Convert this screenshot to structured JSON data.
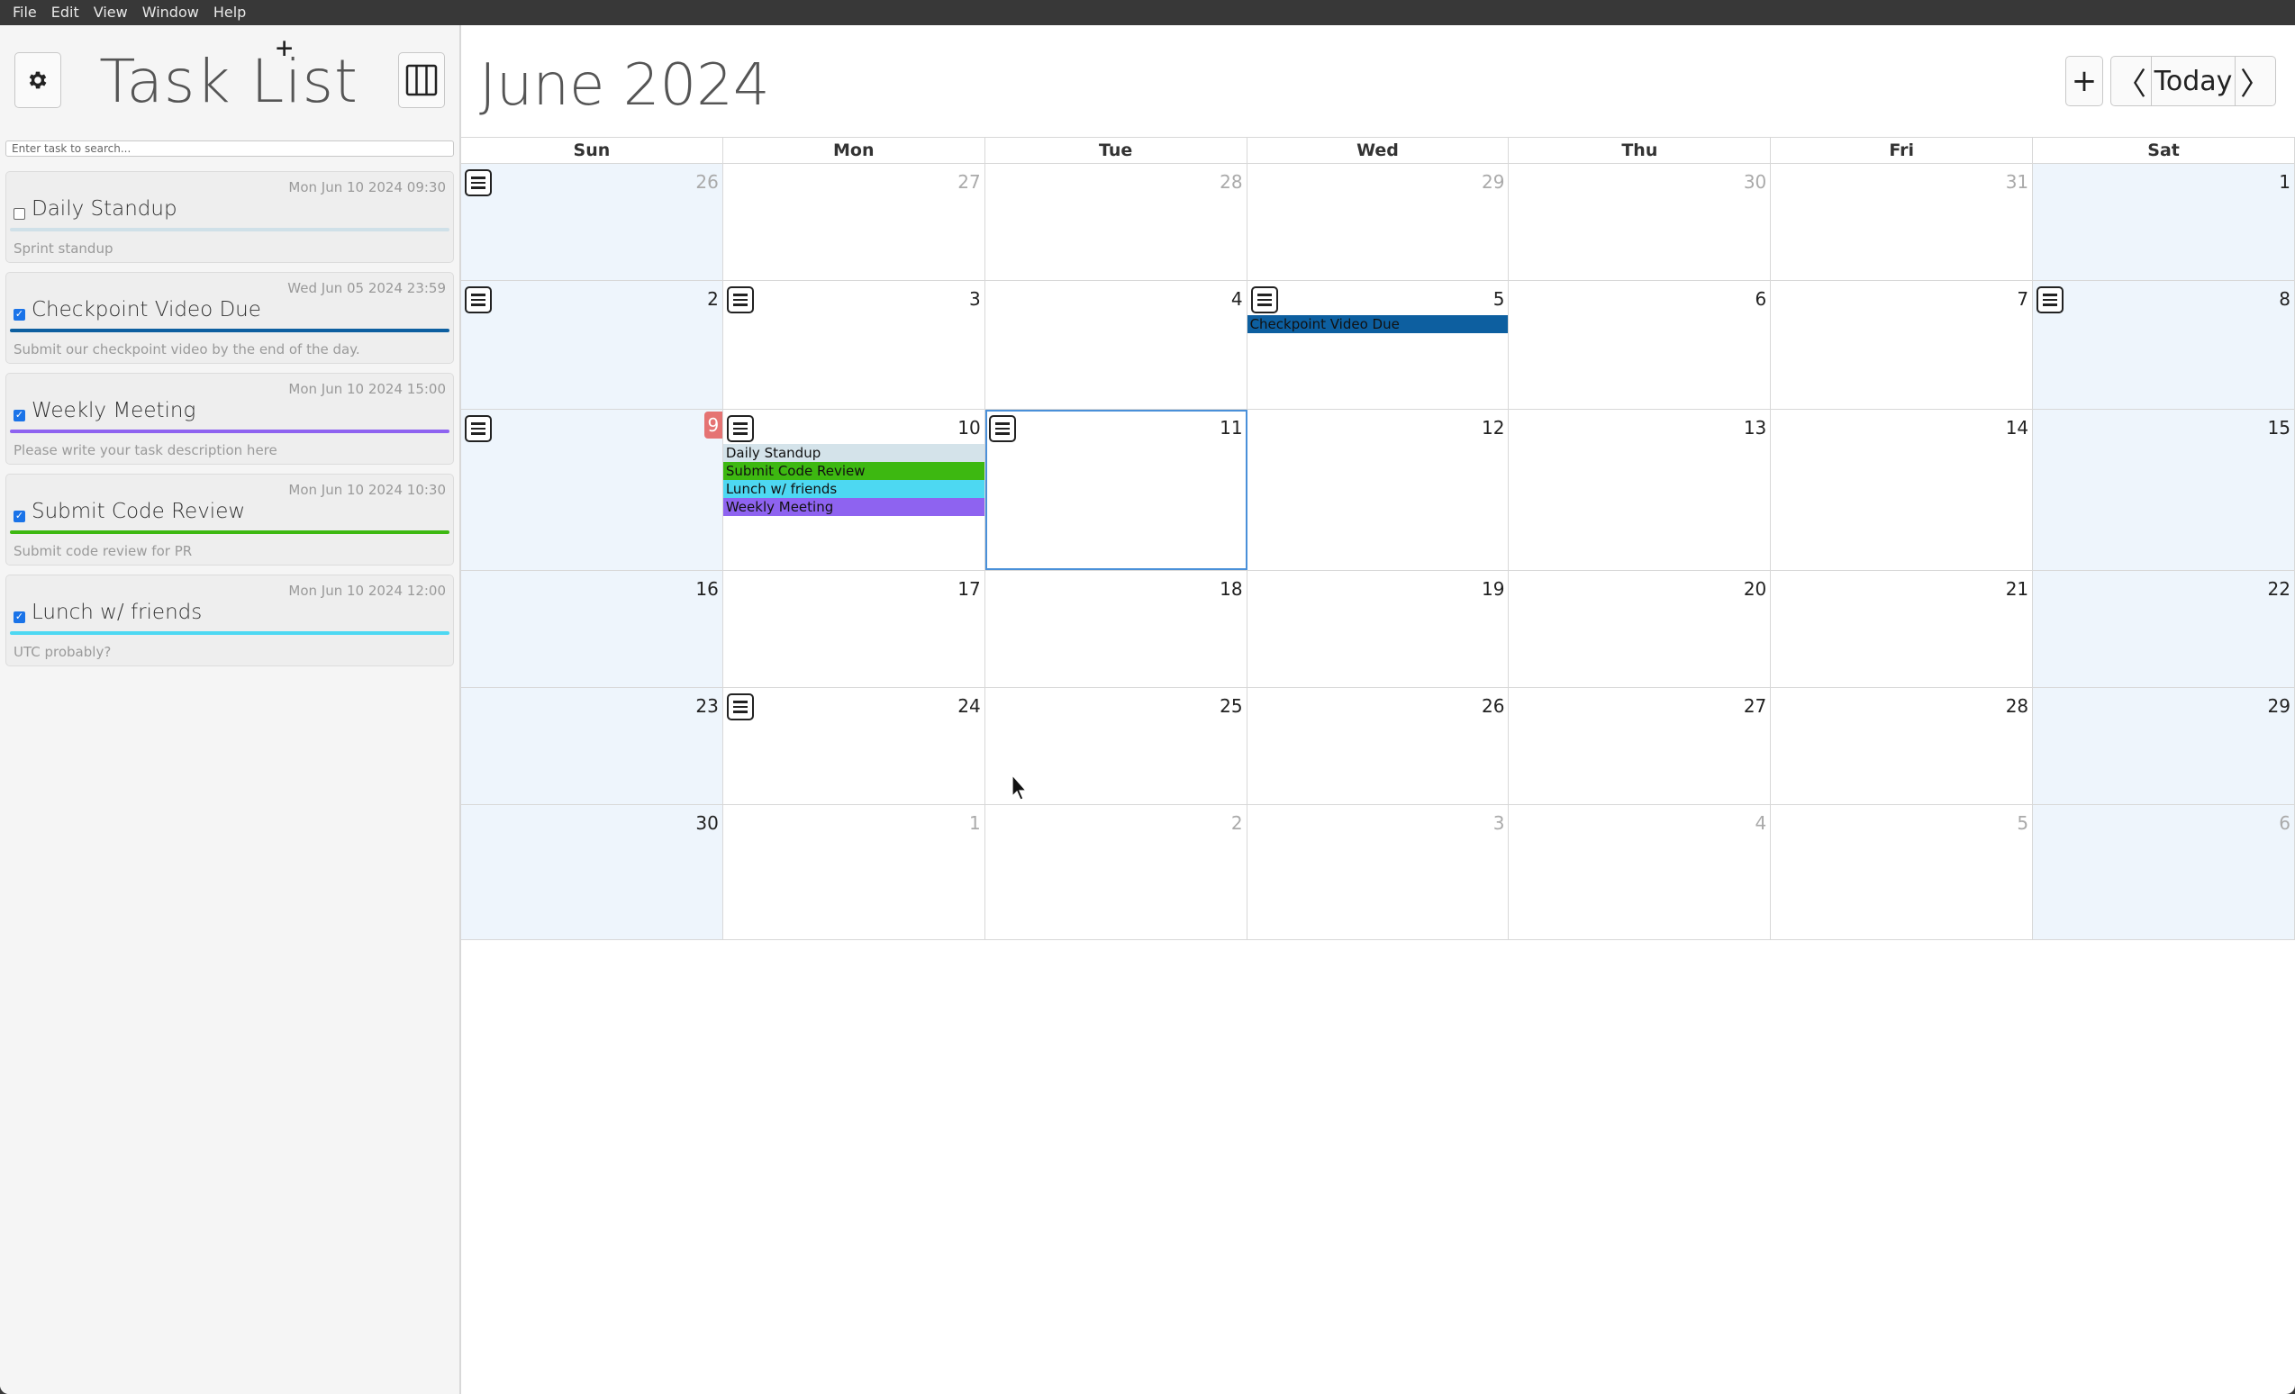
{
  "menu": [
    "File",
    "Edit",
    "View",
    "Window",
    "Help"
  ],
  "sidebar": {
    "title": "Task List",
    "search_placeholder": "Enter task to search...",
    "tasks": [
      {
        "name": "Daily Standup",
        "date": "Mon Jun 10 2024 09:30",
        "description": "Sprint standup",
        "checked": false,
        "color": "#cfe0e8"
      },
      {
        "name": "Checkpoint Video Due",
        "date": "Wed Jun 05 2024 23:59",
        "description": "Submit our checkpoint video by the end of the day.",
        "checked": true,
        "color": "#0d5fa0"
      },
      {
        "name": "Weekly Meeting",
        "date": "Mon Jun 10 2024 15:00",
        "description": "Please write your task description here",
        "checked": true,
        "color": "#8e63f0"
      },
      {
        "name": "Submit Code Review",
        "date": "Mon Jun 10 2024 10:30",
        "description": "Submit code review for PR",
        "checked": true,
        "color": "#3db811"
      },
      {
        "name": "Lunch w/ friends",
        "date": "Mon Jun 10 2024 12:00",
        "description": "UTC probably?",
        "checked": true,
        "color": "#4dd8f2"
      }
    ]
  },
  "calendar": {
    "title": "June 2024",
    "add_label": "+",
    "prev_label": "〈",
    "today_label": "Today",
    "next_label": "〉",
    "weekdays": [
      "Sun",
      "Mon",
      "Tue",
      "Wed",
      "Thu",
      "Fri",
      "Sat"
    ],
    "today": 9,
    "weeks": [
      [
        {
          "d": "26",
          "o": true,
          "n": true
        },
        {
          "d": "27",
          "o": true
        },
        {
          "d": "28",
          "o": true
        },
        {
          "d": "29",
          "o": true
        },
        {
          "d": "30",
          "o": true
        },
        {
          "d": "31",
          "o": true
        },
        {
          "d": "1"
        }
      ],
      [
        {
          "d": "2",
          "n": true
        },
        {
          "d": "3",
          "n": true
        },
        {
          "d": "4"
        },
        {
          "d": "5",
          "n": true,
          "ev": [
            {
              "t": "Checkpoint Video Due",
              "c": "#0d5fa0"
            }
          ]
        },
        {
          "d": "6"
        },
        {
          "d": "7"
        },
        {
          "d": "8",
          "n": true
        }
      ],
      [
        {
          "d": "9",
          "n": true,
          "today": true
        },
        {
          "d": "10",
          "n": true,
          "ev": [
            {
              "t": "Daily Standup",
              "c": "#d4e3ea"
            },
            {
              "t": "Submit Code Review",
              "c": "#3db811"
            },
            {
              "t": "Lunch w/ friends",
              "c": "#4dd8f2"
            },
            {
              "t": "Weekly Meeting",
              "c": "#8e63f0"
            }
          ]
        },
        {
          "d": "11",
          "n": true,
          "sel": true
        },
        {
          "d": "12"
        },
        {
          "d": "13"
        },
        {
          "d": "14"
        },
        {
          "d": "15"
        }
      ],
      [
        {
          "d": "16"
        },
        {
          "d": "17"
        },
        {
          "d": "18"
        },
        {
          "d": "19"
        },
        {
          "d": "20"
        },
        {
          "d": "21"
        },
        {
          "d": "22"
        }
      ],
      [
        {
          "d": "23"
        },
        {
          "d": "24",
          "n": true
        },
        {
          "d": "25"
        },
        {
          "d": "26"
        },
        {
          "d": "27"
        },
        {
          "d": "28"
        },
        {
          "d": "29"
        }
      ],
      [
        {
          "d": "30"
        },
        {
          "d": "1",
          "o": true
        },
        {
          "d": "2",
          "o": true
        },
        {
          "d": "3",
          "o": true
        },
        {
          "d": "4",
          "o": true
        },
        {
          "d": "5",
          "o": true
        },
        {
          "d": "6",
          "o": true
        }
      ]
    ]
  }
}
